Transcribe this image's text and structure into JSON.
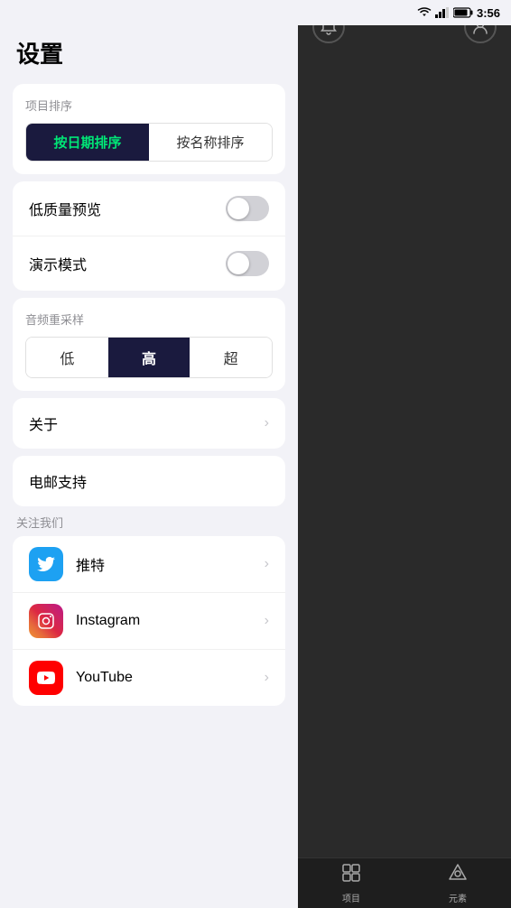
{
  "statusBar": {
    "time": "3:56"
  },
  "leftPanel": {
    "title": "设置",
    "sortSection": {
      "label": "项目排序",
      "buttons": [
        {
          "id": "by-date",
          "label": "按日期排序",
          "active": true
        },
        {
          "id": "by-name",
          "label": "按名称排序",
          "active": false
        }
      ]
    },
    "toggleSection": {
      "items": [
        {
          "id": "low-quality",
          "label": "低质量预览",
          "enabled": false
        },
        {
          "id": "demo-mode",
          "label": "演示模式",
          "enabled": false
        }
      ]
    },
    "audioSection": {
      "label": "音频重采样",
      "buttons": [
        {
          "id": "low",
          "label": "低",
          "active": false
        },
        {
          "id": "high",
          "label": "高",
          "active": true
        },
        {
          "id": "ultra",
          "label": "超",
          "active": false
        }
      ]
    },
    "aboutRow": {
      "label": "关于"
    },
    "emailRow": {
      "label": "电邮支持"
    },
    "followSection": {
      "label": "关注我们",
      "items": [
        {
          "id": "twitter",
          "name": "推特",
          "platform": "twitter"
        },
        {
          "id": "instagram",
          "name": "Instagram",
          "platform": "instagram"
        },
        {
          "id": "youtube",
          "name": "YouTube",
          "platform": "youtube"
        }
      ]
    }
  },
  "rightPanel": {
    "bottomNav": {
      "items": [
        {
          "id": "projects",
          "label": "项目"
        },
        {
          "id": "elements",
          "label": "元素"
        }
      ]
    }
  }
}
